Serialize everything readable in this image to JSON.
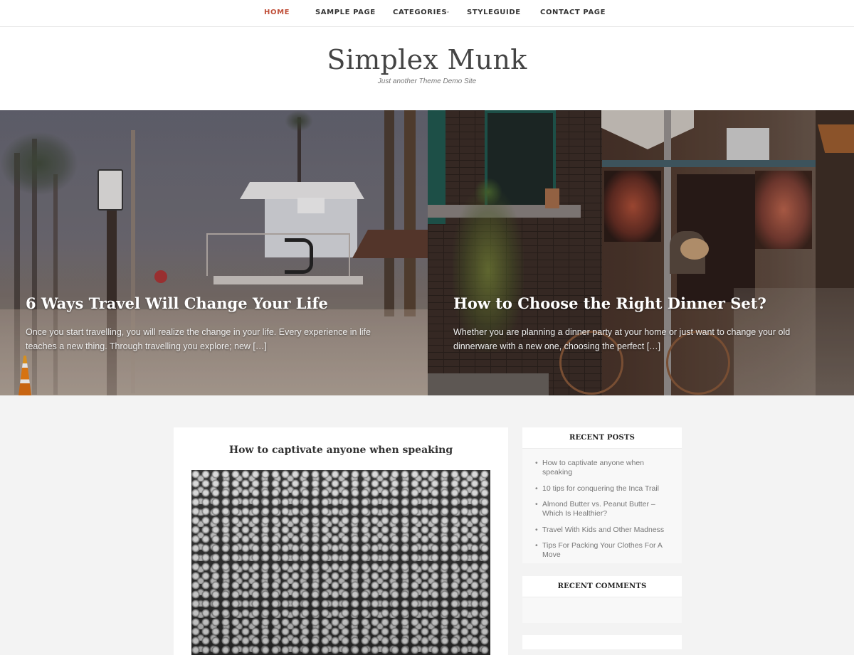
{
  "nav": {
    "items": [
      {
        "label": "Home",
        "active": true,
        "has_submenu": false
      },
      {
        "label": "Sample Page",
        "active": false,
        "has_submenu": true
      },
      {
        "label": "Categories",
        "active": false,
        "has_submenu": true
      },
      {
        "label": "Styleguide",
        "active": false,
        "has_submenu": false
      },
      {
        "label": "Contact Page",
        "active": false,
        "has_submenu": false
      }
    ],
    "submenu_icon": "chevron-down-icon",
    "active_color": "#c0503a"
  },
  "header": {
    "site_title": "Simplex Munk",
    "tagline": "Just another Theme Demo Site"
  },
  "featured": [
    {
      "title": "6 Ways Travel Will Change Your Life",
      "excerpt": "Once you start travelling, you will realize the change in your life. Every experience in life teaches a new thing. Through travelling you explore; new […]",
      "image": "beach lifeguard tower with palm trees"
    },
    {
      "title": "How to Choose the Right Dinner Set?",
      "excerpt": "Whether you are planning a dinner party at your home or just want to change your old dinnerware with a new one, choosing the perfect […]",
      "image": "brick diner storefront with bicycle"
    }
  ],
  "main": {
    "post_title": "How to captivate anyone when speaking",
    "post_image": "black and white crowd audience"
  },
  "sidebar": {
    "recent_posts": {
      "title": "Recent Posts",
      "items": [
        "How to captivate anyone when speaking",
        "10 tips for conquering the Inca Trail",
        "Almond Butter vs. Peanut Butter – Which Is Healthier?",
        "Travel With Kids and Other Madness",
        "Tips For Packing Your Clothes For A Move"
      ]
    },
    "recent_comments": {
      "title": "Recent Comments",
      "items": []
    }
  }
}
